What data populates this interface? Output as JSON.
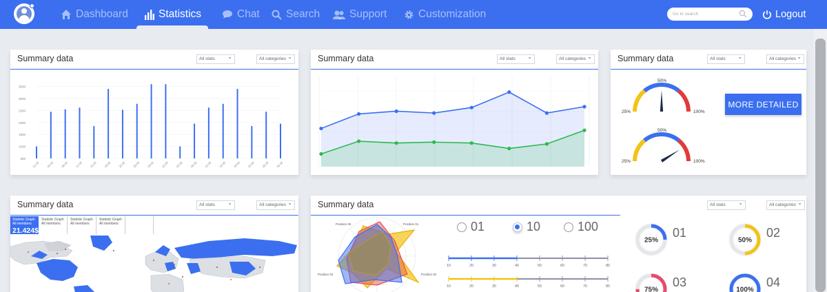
{
  "nav": {
    "items": [
      {
        "label": "Dashboard",
        "icon": "home-icon"
      },
      {
        "label": "Statistics",
        "icon": "bar-chart-icon",
        "active": true
      },
      {
        "label": "Chat",
        "icon": "chat-icon"
      },
      {
        "label": "Search",
        "icon": "search-icon"
      },
      {
        "label": "Support",
        "icon": "support-icon"
      },
      {
        "label": "Customization",
        "icon": "gear-icon"
      }
    ],
    "search_placeholder": "Go to search",
    "logout_label": "Logout",
    "accent": "#3b6ff0"
  },
  "cards": {
    "title": "Summary data",
    "filter_stats": "All stats",
    "filter_categories": "All categories"
  },
  "bar_card": {
    "chart_data": {
      "type": "bar",
      "categories": [
        "01.05",
        "05.05",
        "08.05",
        "12.05",
        "15.05",
        "19.05",
        "22.05",
        "26.05",
        "29.05",
        "02.06",
        "05.06",
        "09.06",
        "12.06",
        "16.06",
        "19.06",
        "23.06",
        "26.06",
        "30.06"
      ],
      "values": [
        1000,
        2450,
        2550,
        2620,
        1850,
        3400,
        2530,
        2780,
        3600,
        1000,
        1950,
        2620,
        2780,
        3400,
        1850,
        2450,
        1950,
        1000
      ],
      "values_full": [
        1000,
        2450,
        2550,
        2620,
        1850,
        3400,
        2530,
        2780,
        3600,
        3600,
        1000,
        1950,
        2620,
        2780,
        3400,
        1850,
        2450,
        1950
      ],
      "y_ticks": [
        "3500",
        "3000",
        "2500",
        "2000",
        "1500",
        "1000",
        "500"
      ],
      "ylim": [
        500,
        3750
      ],
      "color": "#3b6ff0"
    }
  },
  "line_card": {
    "chart_data": {
      "type": "area",
      "x": [
        1,
        2,
        3,
        4,
        5,
        6,
        7,
        8
      ],
      "series": [
        {
          "values": [
            42,
            58,
            61,
            59,
            65,
            82,
            59,
            66
          ],
          "color": "#3b6ff0"
        },
        {
          "values": [
            14,
            28,
            26,
            27,
            26,
            20,
            25,
            40
          ],
          "color": "#2db84d"
        }
      ],
      "ylim": [
        0,
        100
      ]
    }
  },
  "gauge_card": {
    "gauges": [
      {
        "label_left": "25%",
        "label_top": "50%",
        "label_right": "100%",
        "value": 0.5
      },
      {
        "label_left": "25%",
        "label_top": "50%",
        "label_right": "100%",
        "value": 0.82
      }
    ],
    "more_label": "MORE DETAILED"
  },
  "map_card": {
    "legend": [
      {
        "title": "Statistic Graph",
        "sub": "All members",
        "value": "21.424$",
        "selected": true
      },
      {
        "title": "Statistic Graph",
        "sub": "All members"
      },
      {
        "title": "Statistic Graph",
        "sub": "All members"
      },
      {
        "title": "Statistic Graph",
        "sub": "All members"
      }
    ]
  },
  "radar_card": {
    "radar_labels": [
      "Position 05",
      "Position 01",
      "Position 04",
      "Position 02"
    ],
    "radios": [
      {
        "label": "01",
        "selected": false
      },
      {
        "label": "10",
        "selected": true
      },
      {
        "label": "100",
        "selected": false
      }
    ],
    "slider_ticks": [
      "10",
      "20",
      "30",
      "40",
      "50",
      "60",
      "70",
      "80"
    ],
    "sliders": [
      {
        "value": 40,
        "color": "#3b6ff0"
      },
      {
        "value": 40,
        "color": "#f3c316"
      }
    ],
    "donuts": [
      {
        "name": "01",
        "percent": 25,
        "label": "25%",
        "color": "#3b6ff0"
      },
      {
        "name": "02",
        "percent": 50,
        "label": "50%",
        "color": "#f3c316"
      },
      {
        "name": "03",
        "percent": 75,
        "label": "75%",
        "color": "#e9496e"
      },
      {
        "name": "04",
        "percent": 100,
        "label": "100%",
        "color": "#3b6ff0"
      }
    ]
  }
}
